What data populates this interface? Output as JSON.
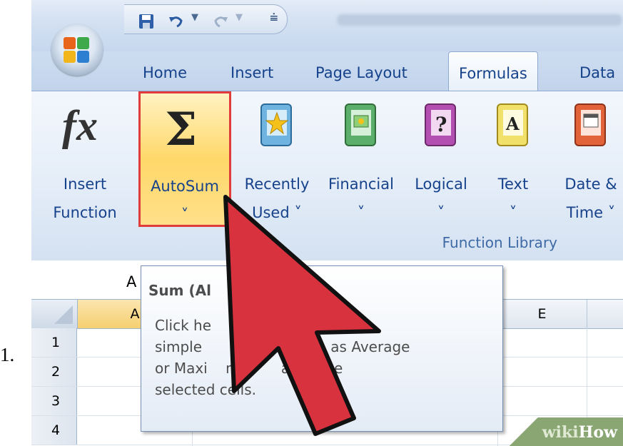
{
  "list_number": "1.",
  "tabs": [
    {
      "label": "Home"
    },
    {
      "label": "Insert"
    },
    {
      "label": "Page Layout"
    },
    {
      "label": "Formulas",
      "active": true
    },
    {
      "label": "Data"
    }
  ],
  "ribbon": {
    "buttons": [
      {
        "label": "Insert\nFunction",
        "icon": "fx-icon"
      },
      {
        "label": "AutoSum\n˅",
        "icon": "sigma-icon",
        "highlighted": true
      },
      {
        "label": "Recently\nUsed ˅",
        "icon": "recently-used-book-icon"
      },
      {
        "label": "Financial\n˅",
        "icon": "financial-book-icon"
      },
      {
        "label": "Logical\n˅",
        "icon": "logical-book-icon"
      },
      {
        "label": "Text\n˅",
        "icon": "text-book-icon"
      },
      {
        "label": "Date &\nTime ˅",
        "icon": "date-time-book-icon"
      }
    ],
    "group_label": "Function Library"
  },
  "name_box": {
    "value": "A"
  },
  "columns": [
    "A",
    "E"
  ],
  "rows": [
    "1",
    "2",
    "3",
    "4"
  ],
  "tooltip": {
    "title": "Sum (Al",
    "lines": [
      "Click he                   esult of a",
      "simple                    such as Average",
      "or Maxi    m V      after the",
      "selected cells."
    ]
  },
  "watermark": {
    "part1": "wiki",
    "part2": "How"
  },
  "colors": {
    "highlight_border": "#e03c3c",
    "cursor_fill": "#d9323f",
    "tab_text": "#15428b",
    "watermark": "#8aa673"
  }
}
